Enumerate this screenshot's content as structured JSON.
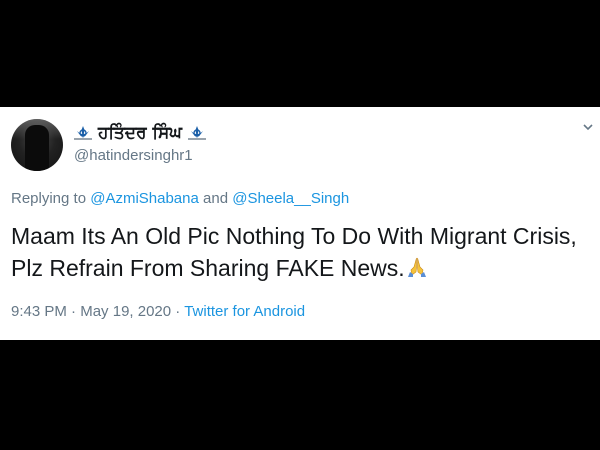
{
  "tweet": {
    "display_name": "ਹਤਿੰਦਰ ਸਿੰਘ",
    "handle": "@hatindersinghr1",
    "reply_prefix": "Replying to",
    "reply_mention_1": "@AzmiShabana",
    "reply_joiner": "and",
    "reply_mention_2": "@Sheela__Singh",
    "text_line_1": "Maam Its An Old Pic Nothing To Do With Migrant Crisis,",
    "text_line_2": "Plz Refrain From Sharing FAKE News.",
    "emoji": "folded-hands-icon",
    "time": "9:43 PM",
    "separator": "·",
    "date": "May 19, 2020",
    "source": "Twitter for Android"
  },
  "colors": {
    "background": "#000000",
    "card": "#ffffff",
    "text_primary": "#14171a",
    "text_secondary": "#657786",
    "link": "#1b95e0"
  }
}
